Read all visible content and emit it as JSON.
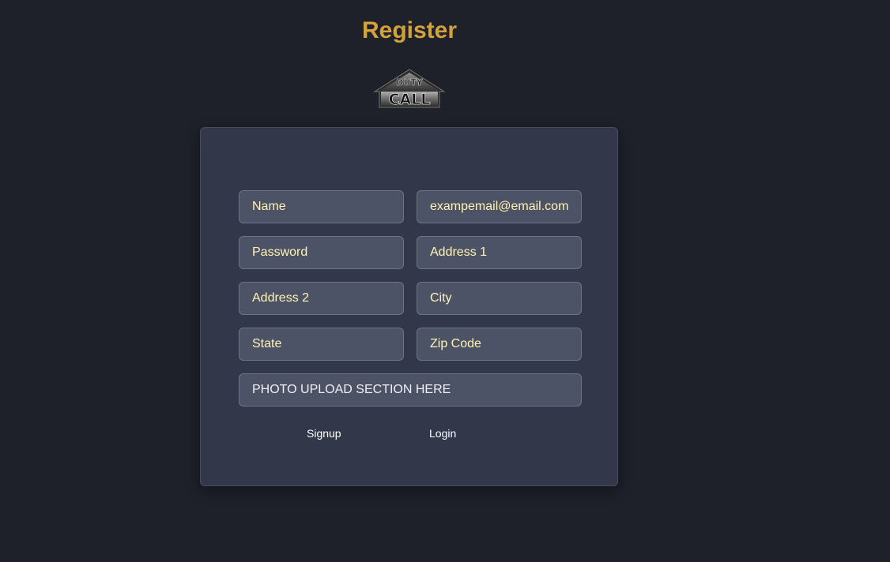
{
  "page": {
    "title": "Register"
  },
  "logo": {
    "icon": "duty-call-logo",
    "text_top": "DUTY",
    "text_bottom": "CALL"
  },
  "form": {
    "name_placeholder": "Name",
    "email_value": "exampemail@email.com",
    "password_placeholder": "Password",
    "address1_placeholder": "Address 1",
    "address2_placeholder": "Address 2",
    "city_placeholder": "City",
    "state_placeholder": "State",
    "zip_placeholder": "Zip Code",
    "photo_upload_text": "PHOTO UPLOAD SECTION HERE",
    "signup_label": "Signup",
    "login_label": "Login"
  },
  "colors": {
    "background": "#1e202a",
    "card": "#32384a",
    "title": "#d4a23c",
    "field_text": "#fff4b3"
  }
}
